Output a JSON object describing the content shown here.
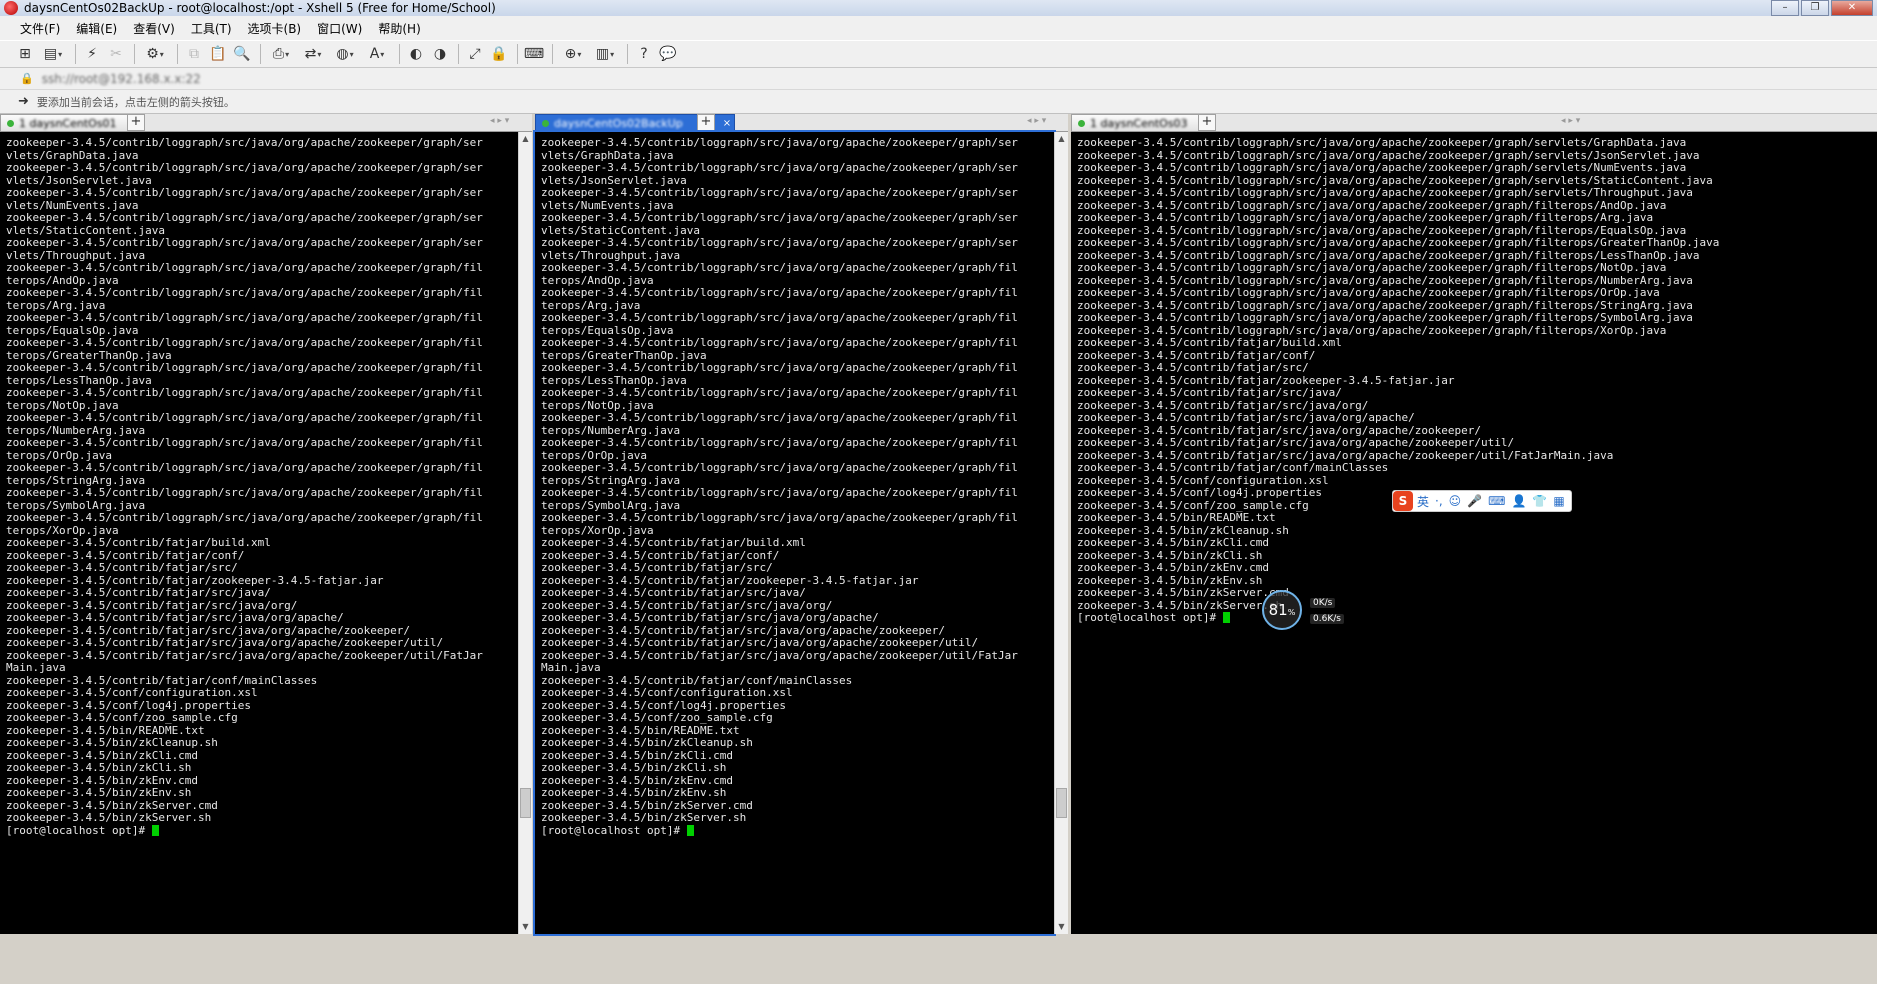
{
  "window": {
    "title": "daysnCentOs02BackUp - root@localhost:/opt - Xshell 5 (Free for Home/School)"
  },
  "menu": [
    "文件(F)",
    "编辑(E)",
    "查看(V)",
    "工具(T)",
    "选项卡(B)",
    "窗口(W)",
    "帮助(H)"
  ],
  "address": {
    "value": "ssh://root@192.168.x.x:22"
  },
  "hint": "要添加当前会话，点击左侧的箭头按钮。",
  "tabs": [
    {
      "label": "1 daysnCentOs01",
      "close": "×"
    },
    {
      "label": "daysnCentOs02BackUp",
      "close": "×"
    },
    {
      "label": "1 daysnCentOs03",
      "close": "×"
    }
  ],
  "tab_add": "+",
  "tab_nav": "◂ ▸ ▾",
  "prompt": "[root@localhost opt]# ",
  "terminal_lines": [
    "zookeeper-3.4.5/contrib/loggraph/src/java/org/apache/zookeeper/graph/servlets/GraphData.java",
    "zookeeper-3.4.5/contrib/loggraph/src/java/org/apache/zookeeper/graph/servlets/JsonServlet.java",
    "zookeeper-3.4.5/contrib/loggraph/src/java/org/apache/zookeeper/graph/servlets/NumEvents.java",
    "zookeeper-3.4.5/contrib/loggraph/src/java/org/apache/zookeeper/graph/servlets/StaticContent.java",
    "zookeeper-3.4.5/contrib/loggraph/src/java/org/apache/zookeeper/graph/servlets/Throughput.java",
    "zookeeper-3.4.5/contrib/loggraph/src/java/org/apache/zookeeper/graph/filterops/AndOp.java",
    "zookeeper-3.4.5/contrib/loggraph/src/java/org/apache/zookeeper/graph/filterops/Arg.java",
    "zookeeper-3.4.5/contrib/loggraph/src/java/org/apache/zookeeper/graph/filterops/EqualsOp.java",
    "zookeeper-3.4.5/contrib/loggraph/src/java/org/apache/zookeeper/graph/filterops/GreaterThanOp.java",
    "zookeeper-3.4.5/contrib/loggraph/src/java/org/apache/zookeeper/graph/filterops/LessThanOp.java",
    "zookeeper-3.4.5/contrib/loggraph/src/java/org/apache/zookeeper/graph/filterops/NotOp.java",
    "zookeeper-3.4.5/contrib/loggraph/src/java/org/apache/zookeeper/graph/filterops/NumberArg.java",
    "zookeeper-3.4.5/contrib/loggraph/src/java/org/apache/zookeeper/graph/filterops/OrOp.java",
    "zookeeper-3.4.5/contrib/loggraph/src/java/org/apache/zookeeper/graph/filterops/StringArg.java",
    "zookeeper-3.4.5/contrib/loggraph/src/java/org/apache/zookeeper/graph/filterops/SymbolArg.java",
    "zookeeper-3.4.5/contrib/loggraph/src/java/org/apache/zookeeper/graph/filterops/XorOp.java",
    "zookeeper-3.4.5/contrib/fatjar/build.xml",
    "zookeeper-3.4.5/contrib/fatjar/conf/",
    "zookeeper-3.4.5/contrib/fatjar/src/",
    "zookeeper-3.4.5/contrib/fatjar/zookeeper-3.4.5-fatjar.jar",
    "zookeeper-3.4.5/contrib/fatjar/src/java/",
    "zookeeper-3.4.5/contrib/fatjar/src/java/org/",
    "zookeeper-3.4.5/contrib/fatjar/src/java/org/apache/",
    "zookeeper-3.4.5/contrib/fatjar/src/java/org/apache/zookeeper/",
    "zookeeper-3.4.5/contrib/fatjar/src/java/org/apache/zookeeper/util/",
    "zookeeper-3.4.5/contrib/fatjar/src/java/org/apache/zookeeper/util/FatJarMain.java",
    "zookeeper-3.4.5/contrib/fatjar/conf/mainClasses",
    "zookeeper-3.4.5/conf/configuration.xsl",
    "zookeeper-3.4.5/conf/log4j.properties",
    "zookeeper-3.4.5/conf/zoo_sample.cfg",
    "zookeeper-3.4.5/bin/README.txt",
    "zookeeper-3.4.5/bin/zkCleanup.sh",
    "zookeeper-3.4.5/bin/zkCli.cmd",
    "zookeeper-3.4.5/bin/zkCli.sh",
    "zookeeper-3.4.5/bin/zkEnv.cmd",
    "zookeeper-3.4.5/bin/zkEnv.sh",
    "zookeeper-3.4.5/bin/zkServer.cmd",
    "zookeeper-3.4.5/bin/zkServer.sh"
  ],
  "overlays": {
    "ime": {
      "logo": "S",
      "mode": "英"
    },
    "netmon": {
      "percent": "81",
      "percent_sign": "%",
      "up": "0K/s",
      "down": "0.6K/s"
    }
  },
  "colors": {
    "terminal_bg": "#000000",
    "terminal_fg": "#e8e8e8",
    "cursor": "#00d000",
    "active_tab": "#2d6ed6"
  }
}
